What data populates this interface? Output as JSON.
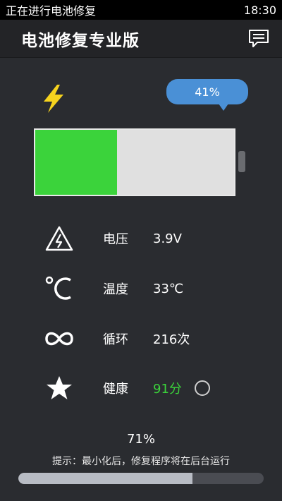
{
  "status_bar": {
    "notification": "正在进行电池修复",
    "time": "18:30"
  },
  "app_bar": {
    "title": "电池修复专业版",
    "menu_icon": "chat-menu-icon"
  },
  "charging": {
    "icon": "lightning-bolt-icon",
    "percent_label": "41%",
    "level_fraction": 0.41,
    "colors": {
      "fill": "#3bd33b",
      "empty": "#e0e0e0",
      "bubble": "#4a90d6"
    }
  },
  "stats": [
    {
      "icon": "high-voltage-icon",
      "label": "电压",
      "value": "3.9V"
    },
    {
      "icon": "celsius-icon",
      "label": "温度",
      "value": "33℃"
    },
    {
      "icon": "infinity-icon",
      "label": "循环",
      "value": "216次"
    },
    {
      "icon": "star-icon",
      "label": "健康",
      "value": "91分"
    }
  ],
  "repair": {
    "progress_label": "71%",
    "progress_fraction": 0.71,
    "hint": "提示：最小化后，修复程序将在后台运行"
  }
}
